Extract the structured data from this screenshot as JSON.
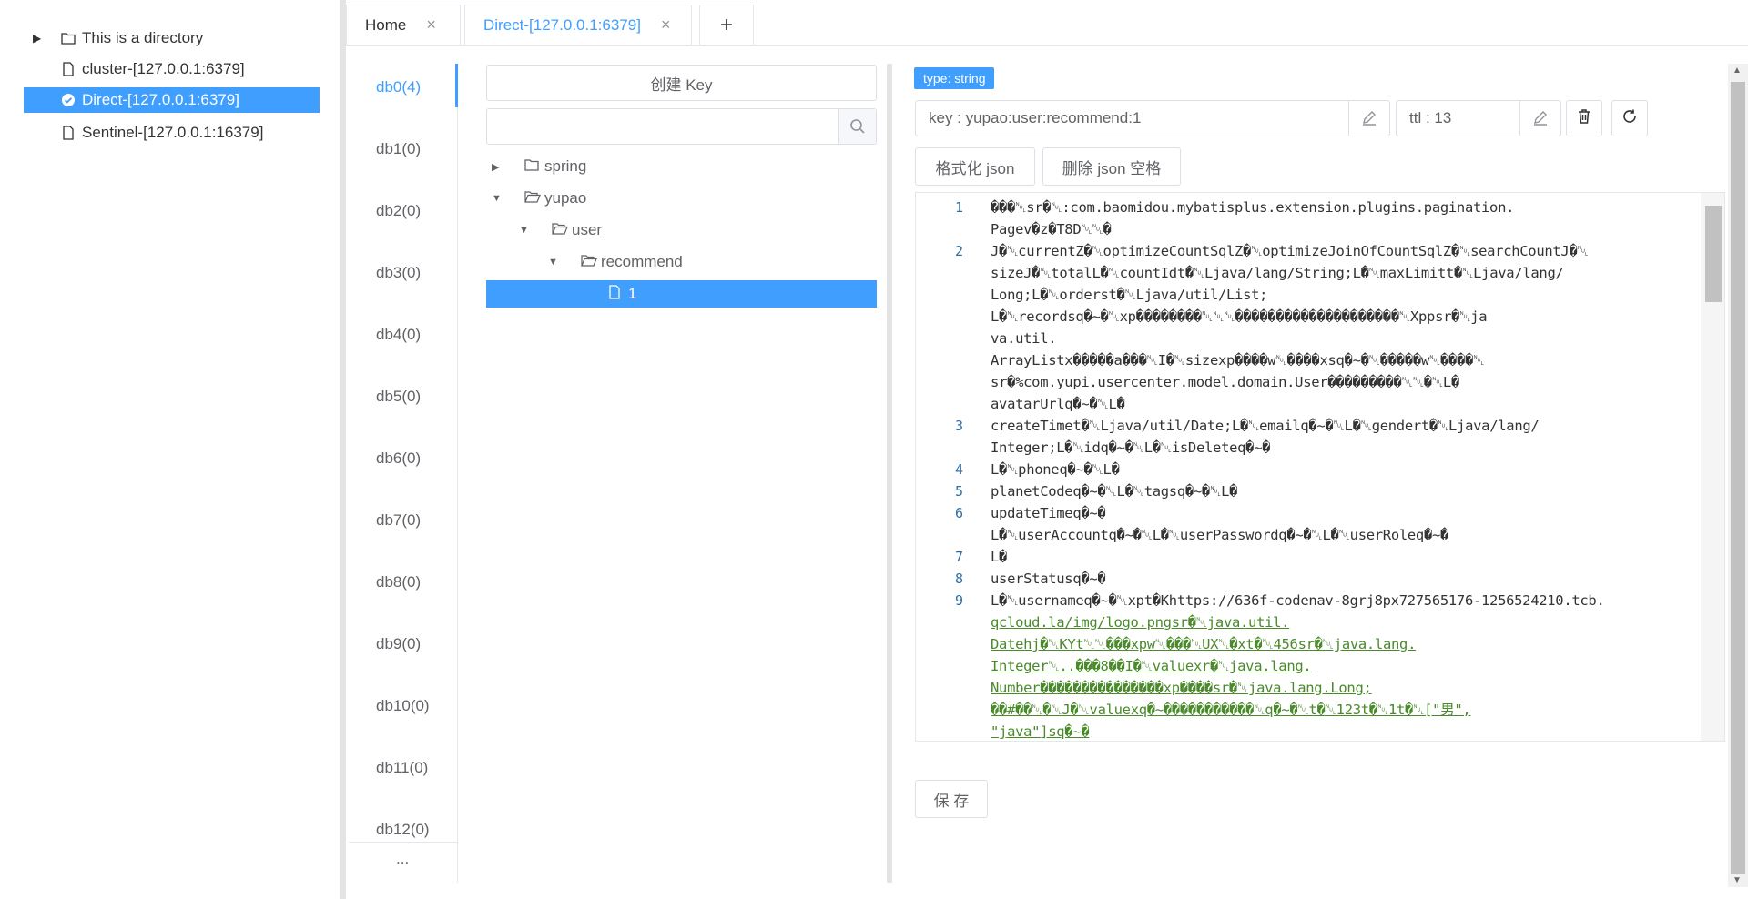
{
  "connections": [
    {
      "label": "This is a directory",
      "icon": "folder-icon",
      "expandable": true
    },
    {
      "label": "cluster-[127.0.0.1:6379]",
      "icon": "file-icon"
    },
    {
      "label": "Direct-[127.0.0.1:6379]",
      "icon": "check-circle-icon",
      "selected": true
    },
    {
      "label": "Sentinel-[127.0.0.1:16379]",
      "icon": "file-icon"
    }
  ],
  "tabs": {
    "home": "Home",
    "direct": "Direct-[127.0.0.1:6379]",
    "close_glyph": "×",
    "add_glyph": "+"
  },
  "dbs": [
    "db0(4)",
    "db1(0)",
    "db2(0)",
    "db3(0)",
    "db4(0)",
    "db5(0)",
    "db6(0)",
    "db7(0)",
    "db8(0)",
    "db9(0)",
    "db10(0)",
    "db11(0)",
    "db12(0)"
  ],
  "db_more": "...",
  "key_panel": {
    "create_key_label": "创建 Key",
    "search_value": ""
  },
  "key_tree": [
    {
      "label": "spring",
      "icon": "folder-icon",
      "expandable": true
    },
    {
      "label": "yupao",
      "icon": "folder-open-icon",
      "expanded": true
    },
    {
      "label": "user",
      "icon": "folder-open-icon",
      "expanded": true
    },
    {
      "label": "recommend",
      "icon": "folder-open-icon",
      "expanded": true
    },
    {
      "label": "1",
      "icon": "file-icon",
      "selected": true
    }
  ],
  "detail": {
    "type_badge": "type: string",
    "key_field": "key : yupao:user:recommend:1",
    "ttl_field": "ttl : 13",
    "format_json_label": "格式化 json",
    "remove_spaces_label": "删除 json 空格",
    "save_label": "保 存"
  },
  "editor_lines": [
    {
      "n": "1",
      "text": "���␀sr�␀:com.baomidou.mybatisplus.extension.plugins.pagination."
    },
    {
      "n": "",
      "text": "Pagev�z�T8D␀␀�"
    },
    {
      "n": "2",
      "text": "J�␀currentZ�␀optimizeCountSqlZ�␀optimizeJoinOfCountSqlZ�␀searchCountJ�␀"
    },
    {
      "n": "",
      "text": "sizeJ�␀totalL�␀countIdt�␀Ljava/lang/String;L�␀maxLimitt�␀Ljava/lang/"
    },
    {
      "n": "",
      "text": "Long;L�␀orderst�␀Ljava/util/List;"
    },
    {
      "n": "",
      "text": "L�␀recordsq�~�␀xp��������␀␀␀��������������������␀Xppsr�␀ja"
    },
    {
      "n": "",
      "text": "va.util."
    },
    {
      "n": "",
      "text": "ArrayListx�����a���␀I�␀sizexp����w␀����xsq�~�␀�����w␀����␀"
    },
    {
      "n": "",
      "text": "sr�%com.yupi.usercenter.model.domain.User���������␀␀�␀L�"
    },
    {
      "n": "",
      "text": "avatarUrlq�~�␀L�"
    },
    {
      "n": "3",
      "text": "createTimet�␀Ljava/util/Date;L�␀emailq�~�␀L�␀gendert�␀Ljava/lang/"
    },
    {
      "n": "",
      "text": "Integer;L�␀idq�~�␀L�␀isDeleteq�~�"
    },
    {
      "n": "4",
      "text": "L�␀phoneq�~�␀L�"
    },
    {
      "n": "5",
      "text": "planetCodeq�~�␀L�␀tagsq�~�␀L�"
    },
    {
      "n": "6",
      "text": "updateTimeq�~�"
    },
    {
      "n": "",
      "text": "L�␀userAccountq�~�␀L�␀userPasswordq�~�␀L�␀userRoleq�~�"
    },
    {
      "n": "7",
      "text": "L�"
    },
    {
      "n": "8",
      "text": "userStatusq�~�"
    },
    {
      "n": "9",
      "text": "L�␀usernameq�~�␀xpt�Khttps://636f-codenav-8grj8px727565176-1256524210.tcb."
    },
    {
      "n": "",
      "text": "qcloud.la/img/logo.pngsr�␀java.util.",
      "link": true
    },
    {
      "n": "",
      "text": "Datehj�␀KYt␀␀���xpw␀���␀UX␀�xt�␀456sr�␀java.lang.",
      "link": true
    },
    {
      "n": "",
      "text": "Integer␀..���8��I�␀valuexr�␀java.lang.",
      "link": true
    },
    {
      "n": "",
      "text": "Number���������������xp����sr�␀java.lang.Long;",
      "link": true
    },
    {
      "n": "",
      "text": "��#��␀�␀J�␀valuexq�~�����������␀q�~�␀t�␀123t�␀1t�␀[\"男\",",
      "link": true
    },
    {
      "n": "",
      "text": "\"java\"]sq�~�",
      "link": true
    }
  ],
  "colors": {
    "accent": "#409eff",
    "link_green": "#4a8a2a",
    "line_number": "#2f6fa8"
  }
}
